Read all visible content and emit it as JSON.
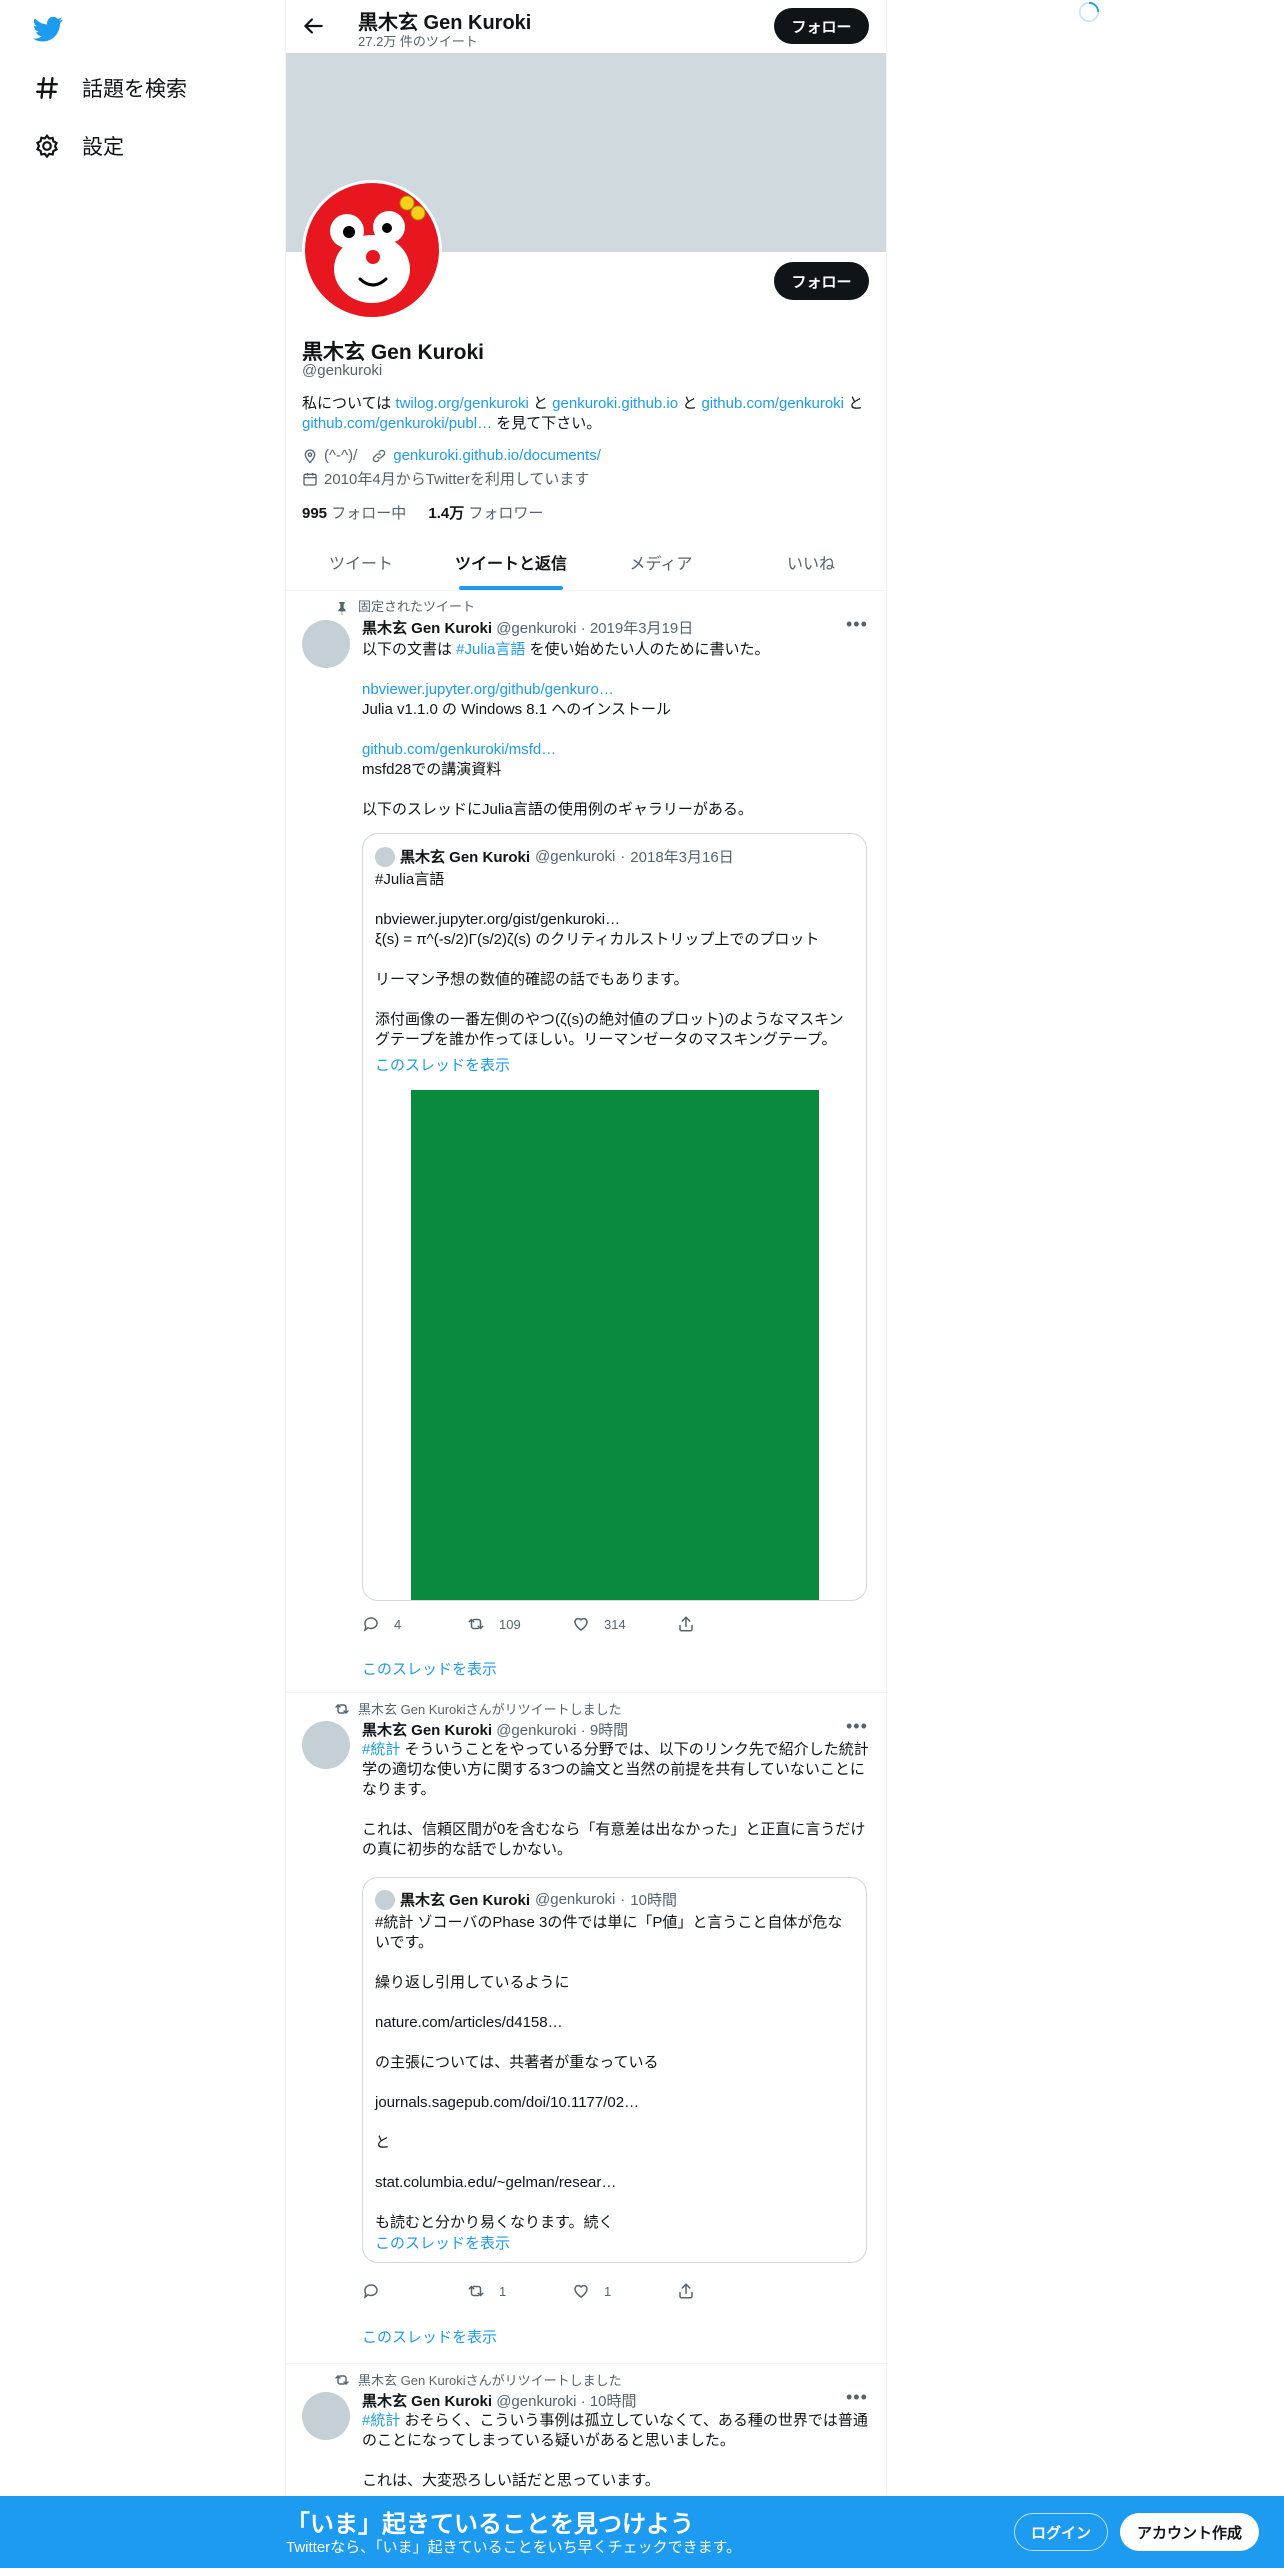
{
  "nav": {
    "explore_label": "話題を検索",
    "settings_label": "設定"
  },
  "header": {
    "title": "黒木玄 Gen Kuroki",
    "tweet_count": "27.2万 件のツイート",
    "follow_label": "フォロー"
  },
  "profile": {
    "name": "黒木玄 Gen Kuroki",
    "handle": "@genkuroki",
    "follow_label": "フォロー",
    "bio": {
      "t1": "私については ",
      "l1": "twilog.org/genkuroki",
      "t2": " と ",
      "l2": "genkuroki.github.io",
      "t3": " と ",
      "l3": "github.com/genkuroki",
      "t4": " と ",
      "l4": "github.com/genkuroki/publ…",
      "t5": " を見て下さい。"
    },
    "location": "(^-^)/",
    "website": "genkuroki.github.io/documents/",
    "joined": "2010年4月からTwitterを利用しています",
    "following_count": "995",
    "following_label": "フォロー中",
    "followers_count": "1.4万",
    "followers_label": "フォロワー"
  },
  "tabs": [
    {
      "label": "ツイート"
    },
    {
      "label": "ツイートと返信"
    },
    {
      "label": "メディア"
    },
    {
      "label": "いいね"
    }
  ],
  "tweets": [
    {
      "context": "固定されたツイート",
      "name": "黒木玄 Gen Kuroki",
      "handle": "@genkuroki",
      "time": "2019年3月19日",
      "body_pre": "以下の文書は ",
      "body_tag": "#Julia言語",
      "body_post": " を使い始めたい人のために書いた。",
      "link1": "nbviewer.jupyter.org/github/genkuro…",
      "line1": "Julia v1.1.0 の Windows 8.1 へのインストール",
      "link2": "github.com/genkuroki/msfd…",
      "line2": "msfd28での講演資料",
      "line3": "以下のスレッドにJulia言語の使用例のギャラリーがある。",
      "quote": {
        "name": "黒木玄 Gen Kuroki",
        "handle": "@genkuroki",
        "time": "2018年3月16日",
        "body": "#Julia言語\n\nnbviewer.jupyter.org/gist/genkuroki…\nξ(s) = π^(-s/2)Γ(s/2)ζ(s) のクリティカルストリップ上でのプロット\n\nリーマン予想の数値的確認の話でもあります。\n\n添付画像の一番左側のやつ(ζ(s)の絶対値のプロット)のようなマスキングテープを誰か作ってほしい。リーマンゼータのマスキングテープ。",
        "show_thread": "このスレッドを表示"
      },
      "replies": "4",
      "retweets": "109",
      "likes": "314",
      "show_thread": "このスレッドを表示"
    },
    {
      "context": "黒木玄 Gen Kurokiさんがリツイートしました",
      "name": "黒木玄 Gen Kuroki",
      "handle": "@genkuroki",
      "time": "9時間",
      "body_tag": "#統計",
      "body_post": " そういうことをやっている分野では、以下のリンク先で紹介した統計学の適切な使い方に関する3つの論文と当然の前提を共有していないことになります。\n\nこれは、信頼区間が0を含むなら「有意差は出なかった」と正直に言うだけの真に初歩的な話でしかない。",
      "quote": {
        "name": "黒木玄 Gen Kuroki",
        "handle": "@genkuroki",
        "time": "10時間",
        "body": "#統計 ゾコーバのPhase 3の件では単に「P値」と言うこと自体が危ないです。\n\n繰り返し引用しているように\n\nnature.com/articles/d4158…\n\nの主張については、共著者が重なっている\n\njournals.sagepub.com/doi/10.1177/02…\n\nと\n\nstat.columbia.edu/~gelman/resear…\n\nも読むと分かり易くなります。続く",
        "show_thread": "このスレッドを表示"
      },
      "replies": "",
      "retweets": "1",
      "likes": "1",
      "show_thread": "このスレッドを表示"
    },
    {
      "context": "黒木玄 Gen Kurokiさんがリツイートしました",
      "name": "黒木玄 Gen Kuroki",
      "handle": "@genkuroki",
      "time": "10時間",
      "body_tag": "#統計",
      "body_post": " おそらく、こういう事例は孤立していなくて、ある種の世界では普通のことになってしまっている疑いがあると思いました。\n\nこれは、大変恐ろしい話だと思っています。"
    }
  ],
  "bottom": {
    "title": "「いま」起きていることを見つけよう",
    "subtitle": "Twitterなら、「いま」起きていることをいち早くチェックできます。",
    "login_label": "ログイン",
    "signup_label": "アカウント作成"
  },
  "colors": {
    "accent": "#1d9bf0",
    "banner": "#cfd9de",
    "attached_image": "#098a3c",
    "avatar_red": "#e8171f"
  }
}
